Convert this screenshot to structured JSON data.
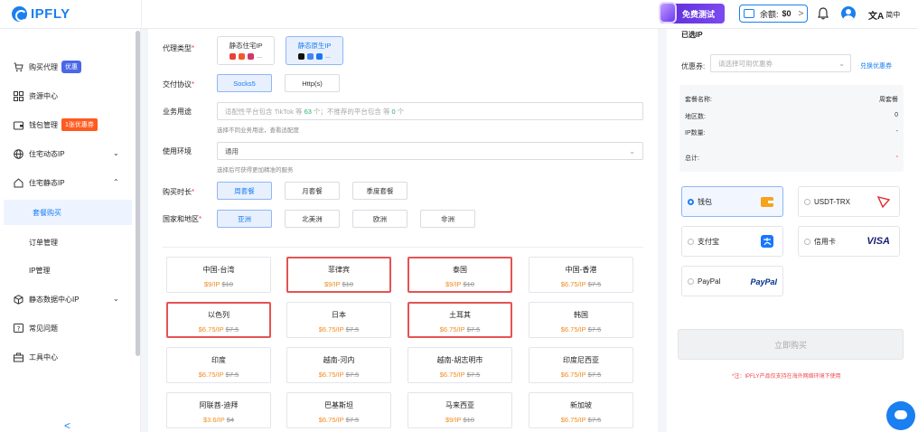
{
  "header": {
    "brand": "IPFLY",
    "trial_label": "免费测试",
    "balance_label": "余额:",
    "balance_value": "$0",
    "balance_chev": ">",
    "lang": "简中"
  },
  "sidebar": {
    "items": [
      {
        "label": "购买代理",
        "badge": "优惠"
      },
      {
        "label": "资源中心"
      },
      {
        "label": "钱包管理",
        "badge": "1张优惠券"
      },
      {
        "label": "住宅动态IP"
      },
      {
        "label": "住宅静态IP"
      },
      {
        "label": "套餐购买"
      },
      {
        "label": "订单管理"
      },
      {
        "label": "IP管理"
      },
      {
        "label": "静态数据中心IP"
      },
      {
        "label": "常见问题"
      },
      {
        "label": "工具中心"
      }
    ],
    "collapse": "<"
  },
  "form": {
    "proxy_type_label": "代理类型",
    "proxy_types": [
      {
        "label": "静态住宅IP"
      },
      {
        "label": "静态原生IP"
      }
    ],
    "ellipsis": "...",
    "protocol_label": "交付协议",
    "protocols": [
      "Socks5",
      "Http(s)"
    ],
    "usage_label": "业务用途",
    "usage_placeholder_a": "适配性平台包含 TikTok 等",
    "usage_count_a": "63",
    "usage_placeholder_b": "个；不推荐的平台包含 等",
    "usage_count_b": "0",
    "usage_placeholder_c": "个",
    "usage_hint": "选择不同业务用途，查看适配度",
    "env_label": "使用环境",
    "env_value": "通用",
    "env_chev": "⌄",
    "env_hint": "选择后可获得更加精准的服务",
    "duration_label": "购买时长",
    "durations": [
      "周套餐",
      "月套餐",
      "季度套餐"
    ],
    "region_label": "国家和地区",
    "regions": [
      "亚洲",
      "北美洲",
      "欧洲",
      "非洲"
    ]
  },
  "locations": [
    {
      "name": "中国-台湾",
      "price": "$9/IP",
      "orig": "$10"
    },
    {
      "name": "菲律宾",
      "price": "$9/IP",
      "orig": "$10"
    },
    {
      "name": "泰国",
      "price": "$9/IP",
      "orig": "$10"
    },
    {
      "name": "中国-香港",
      "price": "$6.75/IP",
      "orig": "$7.5"
    },
    {
      "name": "以色列",
      "price": "$6.75/IP",
      "orig": "$7.5"
    },
    {
      "name": "日本",
      "price": "$6.75/IP",
      "orig": "$7.5"
    },
    {
      "name": "土耳其",
      "price": "$6.75/IP",
      "orig": "$7.5"
    },
    {
      "name": "韩国",
      "price": "$6.75/IP",
      "orig": "$7.5"
    },
    {
      "name": "印度",
      "price": "$6.75/IP",
      "orig": "$7.5"
    },
    {
      "name": "越南-河内",
      "price": "$6.75/IP",
      "orig": "$7.5"
    },
    {
      "name": "越南-胡志明市",
      "price": "$6.75/IP",
      "orig": "$7.5"
    },
    {
      "name": "印度尼西亚",
      "price": "$6.75/IP",
      "orig": "$7.5"
    },
    {
      "name": "阿联酋-迪拜",
      "price": "$3.6/IP",
      "orig": "$4"
    },
    {
      "name": "巴基斯坦",
      "price": "$6.75/IP",
      "orig": "$7.5"
    },
    {
      "name": "马来西亚",
      "price": "$9/IP",
      "orig": "$10"
    },
    {
      "name": "新加坡",
      "price": "$6.75/IP",
      "orig": "$7.5"
    }
  ],
  "order": {
    "title": "已选IP",
    "coupon_label": "优惠券:",
    "coupon_placeholder": "请选择可用优惠券",
    "coupon_chev": "⌄",
    "coupon_link": "兑换优惠券",
    "summary": [
      {
        "label": "套餐名称:",
        "value": "周套餐"
      },
      {
        "label": "地区数:",
        "value": "0"
      },
      {
        "label": "IP数量:",
        "value": "-"
      },
      {
        "label": "总计:",
        "value": "-"
      }
    ],
    "payments": [
      {
        "label": "钱包"
      },
      {
        "label": "USDT-TRX"
      },
      {
        "label": "支付宝"
      },
      {
        "label": "信用卡"
      },
      {
        "label": "PayPal"
      }
    ],
    "visa_text": "VISA",
    "paypal_text": "PayPal",
    "buy_label": "立即购买",
    "notice": "*注：IPFLY产品仅支持在海外网络环境下使用"
  },
  "colors": {
    "primary": "#1a7ff0",
    "highlight_border": "#e55353",
    "price": "#f08a1c"
  }
}
